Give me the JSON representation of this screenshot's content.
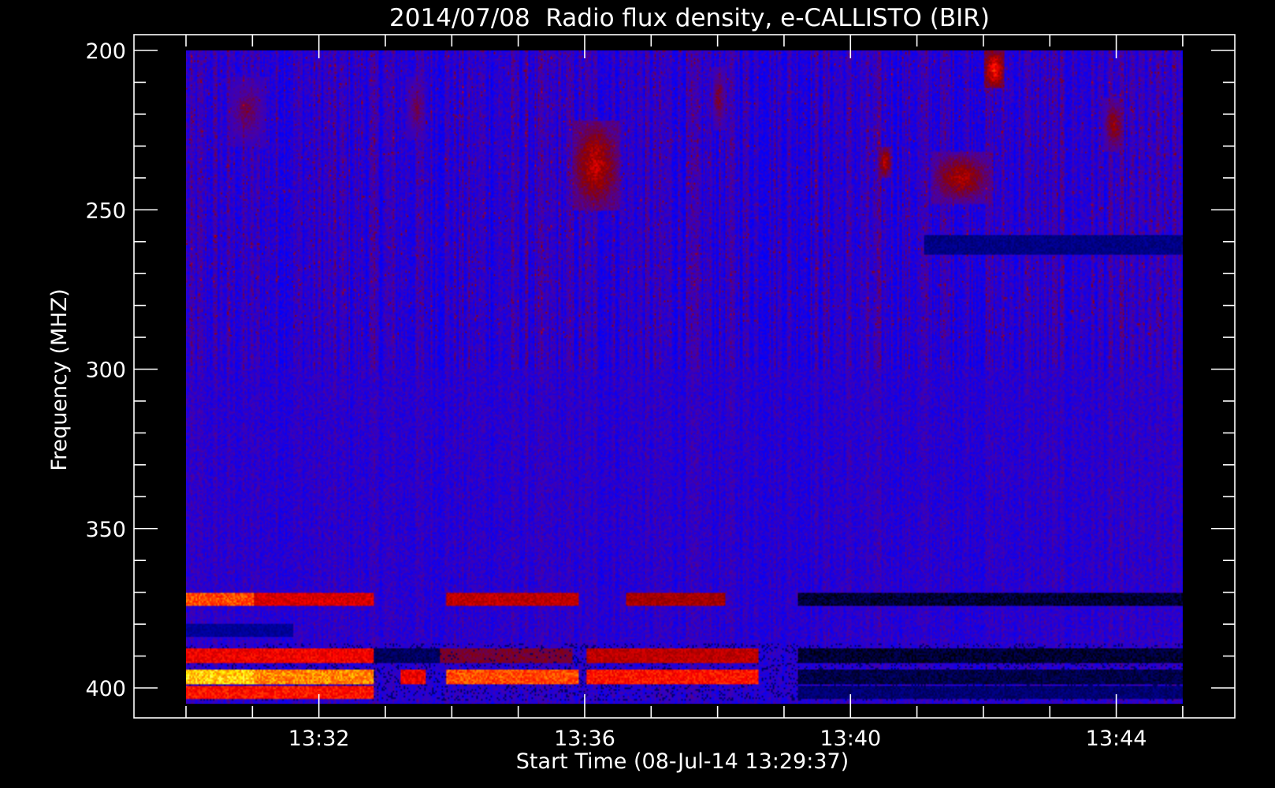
{
  "chart_data": {
    "type": "heatmap",
    "title": "2014/07/08  Radio flux density, e-CALLISTO (BIR)",
    "xlabel": "Start Time (08-Jul-14 13:29:37)",
    "ylabel": "Frequency (MHZ)",
    "x_tick_labels": [
      "13:32",
      "13:36",
      "13:40",
      "13:44"
    ],
    "x_tick_minutes": [
      2.383,
      6.383,
      10.383,
      14.383
    ],
    "y_ticks": [
      200,
      250,
      300,
      350,
      400
    ],
    "ylim": [
      200,
      405
    ],
    "y_reversed": true,
    "data_time_range_minutes": [
      0.383,
      15.383
    ],
    "axis_time_range_minutes": [
      -0.4,
      16.167
    ],
    "colors": {
      "background": "#0000ff",
      "frame": "#ffffff",
      "page": "#000000"
    },
    "colormap": [
      "#000000",
      "#0000ff",
      "#8b0000",
      "#ff0000",
      "#ff8c00",
      "#ffff00",
      "#ffffff"
    ],
    "bursts": [
      {
        "t0": 6.2,
        "t1": 6.9,
        "f0": 222,
        "f1": 250,
        "intensity": 0.55
      },
      {
        "t0": 12.4,
        "t1": 12.7,
        "f0": 200,
        "f1": 212,
        "intensity": 0.7
      },
      {
        "t0": 11.6,
        "t1": 12.5,
        "f0": 232,
        "f1": 248,
        "intensity": 0.5
      },
      {
        "t0": 1.0,
        "t1": 1.6,
        "f0": 208,
        "f1": 230,
        "intensity": 0.35
      },
      {
        "t0": 3.7,
        "t1": 4.0,
        "f0": 208,
        "f1": 228,
        "intensity": 0.35
      },
      {
        "t0": 10.8,
        "t1": 11.0,
        "f0": 230,
        "f1": 240,
        "intensity": 0.55
      },
      {
        "t0": 14.2,
        "t1": 14.5,
        "f0": 215,
        "f1": 232,
        "intensity": 0.45
      },
      {
        "t0": 8.3,
        "t1": 8.5,
        "f0": 205,
        "f1": 225,
        "intensity": 0.4
      }
    ],
    "bands": [
      {
        "f0": 370,
        "f1": 374,
        "segments": [
          [
            0.383,
            1.4,
            0.75
          ],
          [
            1.4,
            3.2,
            0.55
          ],
          [
            4.3,
            6.3,
            0.5
          ],
          [
            7.0,
            8.5,
            0.45
          ],
          [
            9.6,
            15.383,
            -1
          ]
        ]
      },
      {
        "f0": 387.5,
        "f1": 392,
        "segments": [
          [
            0.383,
            3.2,
            0.6
          ],
          [
            3.2,
            4.2,
            -0.8
          ],
          [
            4.2,
            6.2,
            0.35
          ],
          [
            6.4,
            9.0,
            0.5
          ],
          [
            9.6,
            15.383,
            -1
          ]
        ]
      },
      {
        "f0": 394,
        "f1": 399,
        "segments": [
          [
            0.383,
            1.4,
            0.95
          ],
          [
            1.4,
            3.2,
            0.85
          ],
          [
            3.6,
            4.0,
            0.6
          ],
          [
            4.3,
            6.3,
            0.75
          ],
          [
            6.4,
            9.0,
            0.65
          ],
          [
            9.6,
            15.383,
            -0.9
          ]
        ]
      },
      {
        "f0": 399.5,
        "f1": 403.5,
        "segments": [
          [
            0.383,
            3.2,
            0.65
          ],
          [
            9.6,
            15.383,
            -0.7
          ]
        ]
      },
      {
        "f0": 258,
        "f1": 264,
        "segments": [
          [
            11.5,
            15.383,
            -0.6
          ]
        ]
      },
      {
        "f0": 380,
        "f1": 384,
        "segments": [
          [
            0.383,
            2.0,
            -0.5
          ]
        ]
      }
    ]
  }
}
